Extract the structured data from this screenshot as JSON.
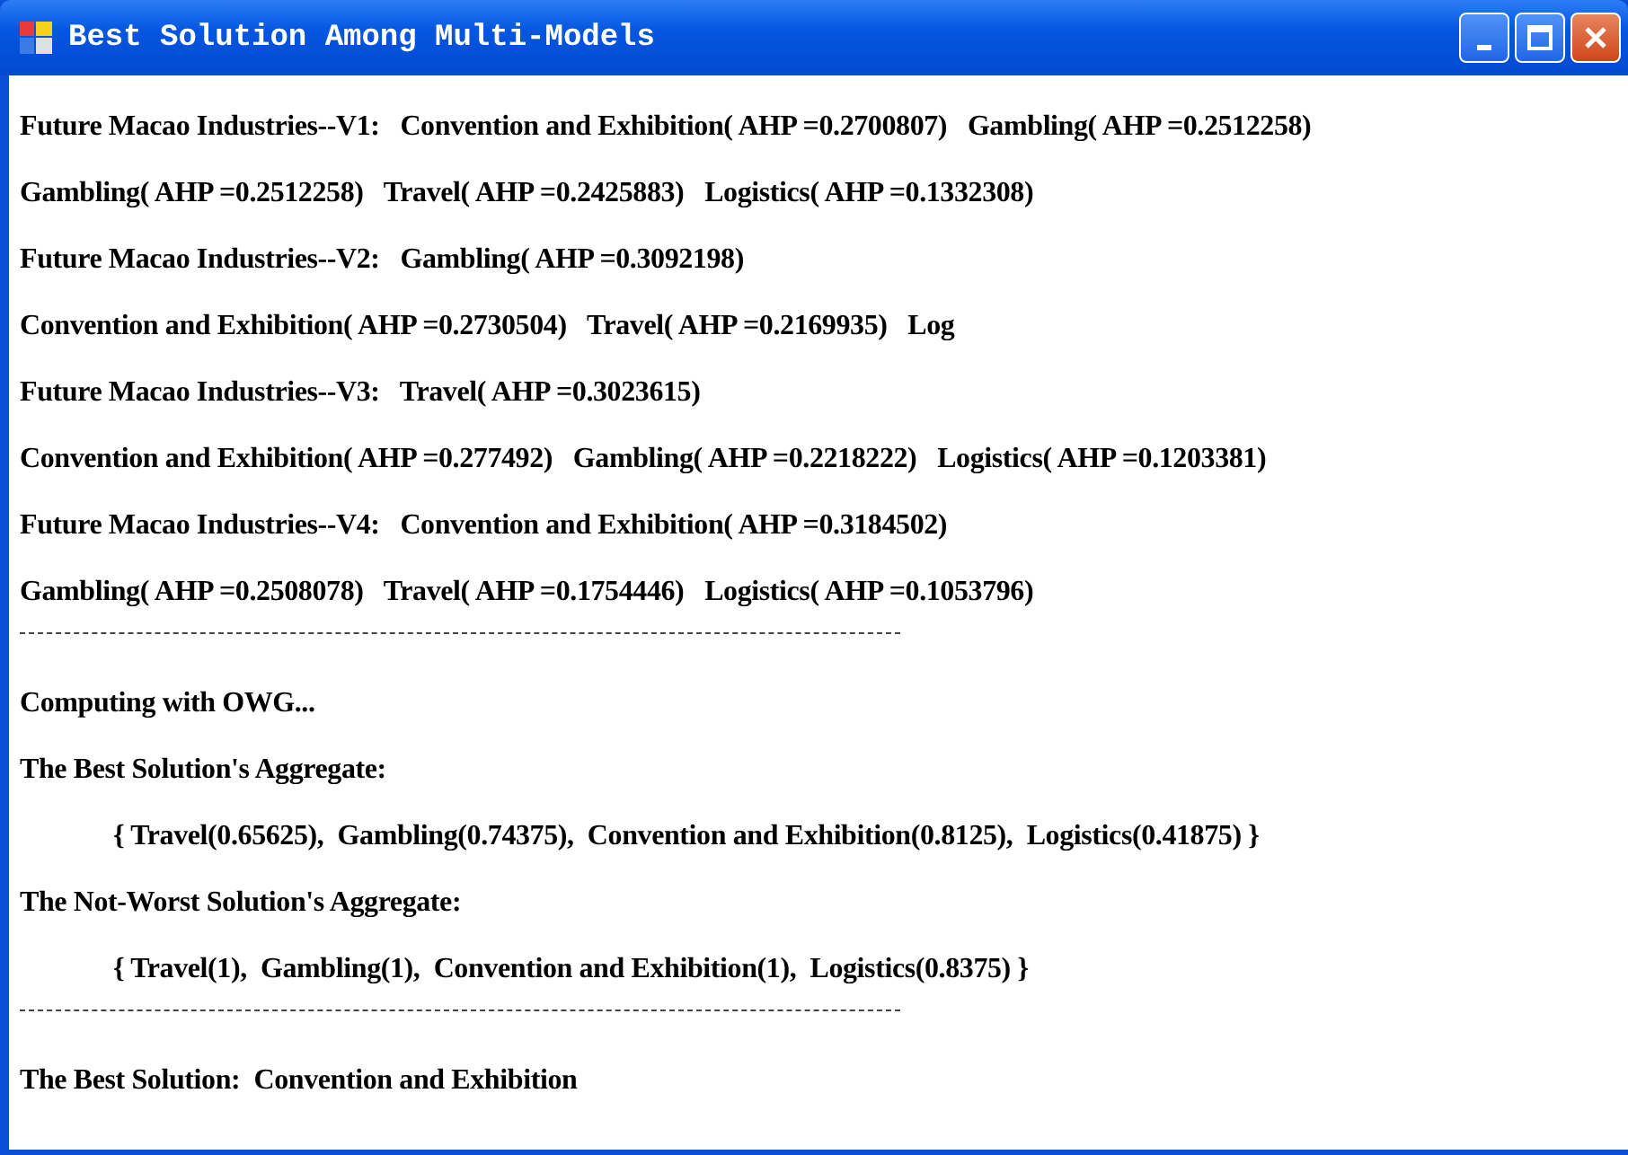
{
  "window": {
    "title": "Best Solution Among Multi-Models",
    "buttons": [
      {
        "kind": "minimize"
      },
      {
        "kind": "maximize"
      },
      {
        "kind": "close"
      }
    ]
  },
  "lines": [
    {
      "kind": "text",
      "text": "Future Macao Industries--V1:   Convention and Exhibition( AHP =0.2700807)   Gambling( AHP =0.2512258)"
    },
    {
      "kind": "text",
      "text": "Gambling( AHP =0.2512258)   Travel( AHP =0.2425883)   Logistics( AHP =0.1332308)"
    },
    {
      "kind": "text",
      "text": "Future Macao Industries--V2:   Gambling( AHP =0.3092198)"
    },
    {
      "kind": "text",
      "text": "Convention and Exhibition( AHP =0.2730504)   Travel( AHP =0.2169935)   Log"
    },
    {
      "kind": "text",
      "text": "Future Macao Industries--V3:   Travel( AHP =0.3023615)"
    },
    {
      "kind": "text",
      "text": "Convention and Exhibition( AHP =0.277492)   Gambling( AHP =0.2218222)   Logistics( AHP =0.1203381)"
    },
    {
      "kind": "text",
      "text": "Future Macao Industries--V4:   Convention and Exhibition( AHP =0.3184502)"
    },
    {
      "kind": "text",
      "text": "Gambling( AHP =0.2508078)   Travel( AHP =0.1754446)   Logistics( AHP =0.1053796)"
    },
    {
      "kind": "divider"
    },
    {
      "kind": "text",
      "text": "Computing with OWG..."
    },
    {
      "kind": "text",
      "text": "The Best Solution's Aggregate:"
    },
    {
      "kind": "indented",
      "text": "{ Travel(0.65625),  Gambling(0.74375),  Convention and Exhibition(0.8125),  Logistics(0.41875) }"
    },
    {
      "kind": "text",
      "text": "The Not-Worst Solution's Aggregate:"
    },
    {
      "kind": "indented",
      "text": "{ Travel(1),  Gambling(1),  Convention and Exhibition(1),  Logistics(0.8375) }"
    },
    {
      "kind": "divider"
    },
    {
      "kind": "text",
      "text": "The Best Solution:  Convention and Exhibition"
    }
  ]
}
